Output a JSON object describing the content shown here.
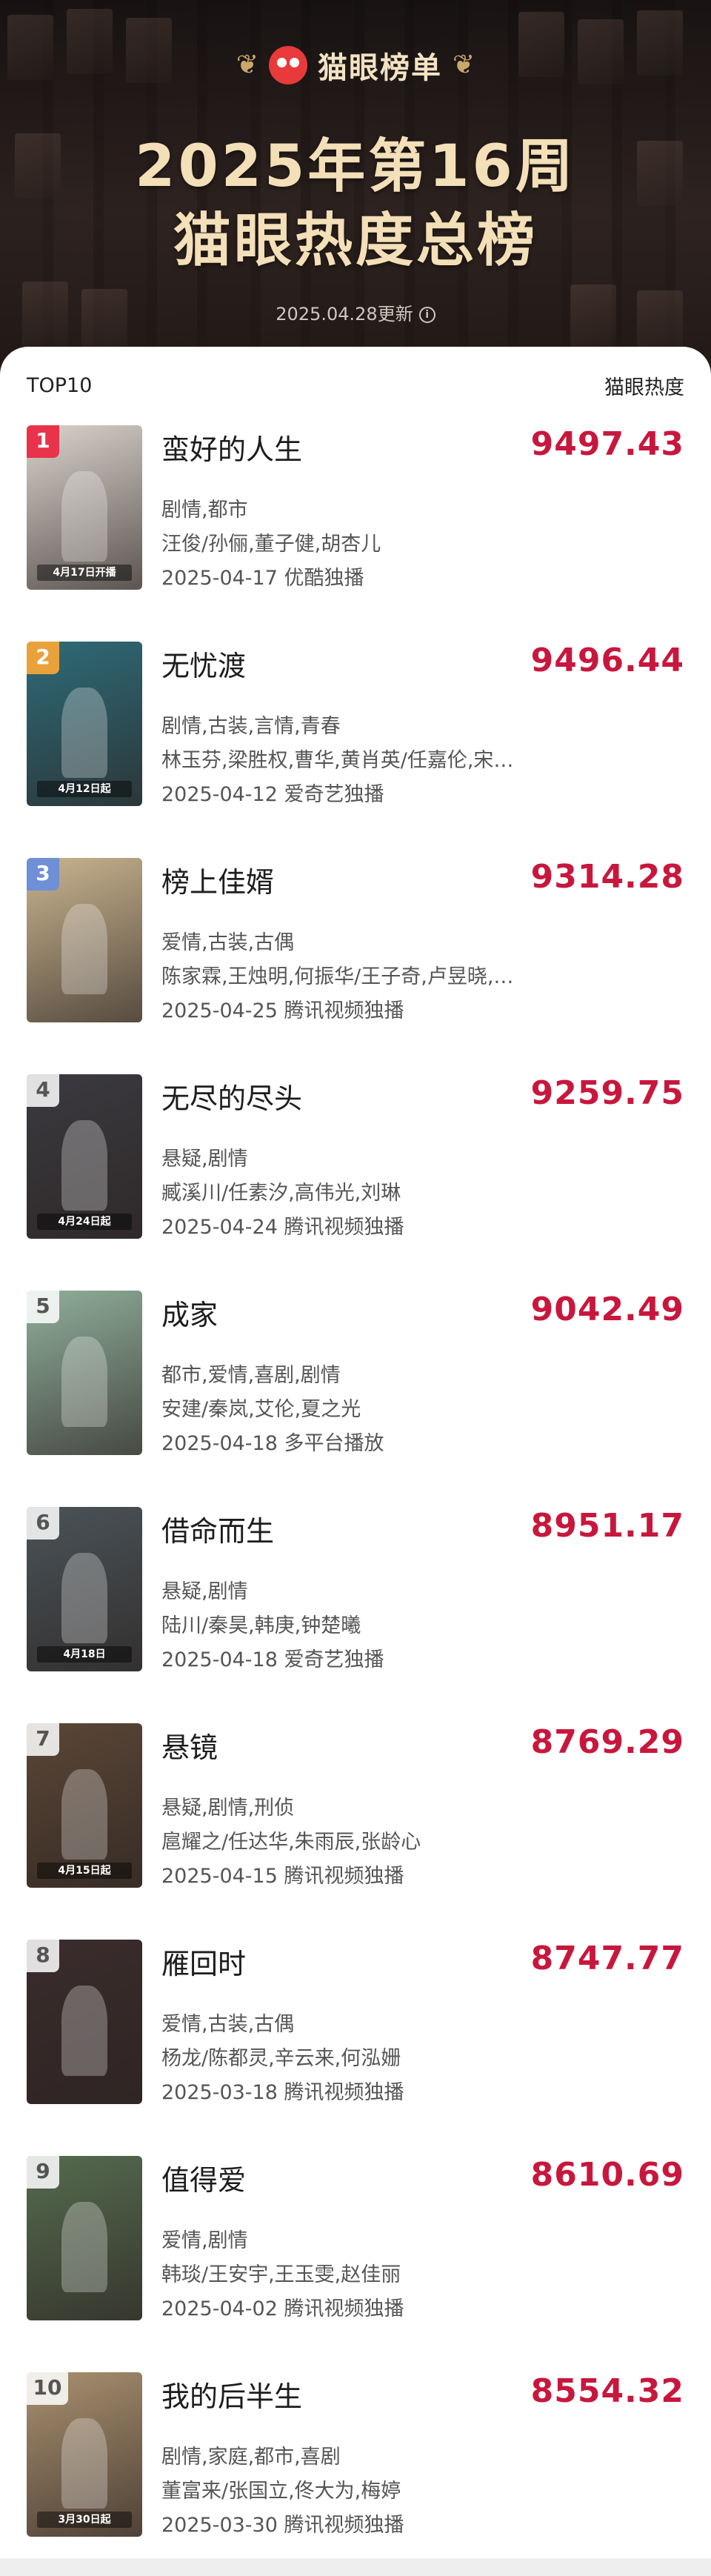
{
  "header": {
    "brand": "猫眼榜单",
    "title_line1": "2025年第16周",
    "title_line2": "猫眼热度总榜",
    "update_text": "2025.04.28更新",
    "info_icon": "info-icon"
  },
  "list_header": {
    "left": "TOP10",
    "right": "猫眼热度"
  },
  "items": [
    {
      "rank": "1",
      "title": "蛮好的人生",
      "heat": "9497.43",
      "genres": "剧情,都市",
      "cast": "汪俊/孙俪,董子健,胡杏儿",
      "release": "2025-04-17 优酷独播",
      "poster_tag": "4月17日开播",
      "poster_color": "#d9d3cc"
    },
    {
      "rank": "2",
      "title": "无忧渡",
      "heat": "9496.44",
      "genres": "剧情,古装,言情,青春",
      "cast": "林玉芬,梁胜权,曹华,黄肖英/任嘉伦,宋…",
      "release": "2025-04-12 爱奇艺独播",
      "poster_tag": "4月12日起",
      "poster_color": "#2e6b78"
    },
    {
      "rank": "3",
      "title": "榜上佳婿",
      "heat": "9314.28",
      "genres": "爱情,古装,古偶",
      "cast": "陈家霖,王烛明,何振华/王子奇,卢昱晓,…",
      "release": "2025-04-25 腾讯视频独播",
      "poster_tag": "",
      "poster_color": "#c9b48f"
    },
    {
      "rank": "4",
      "title": "无尽的尽头",
      "heat": "9259.75",
      "genres": "悬疑,剧情",
      "cast": "臧溪川/任素汐,高伟光,刘琳",
      "release": "2025-04-24 腾讯视频独播",
      "poster_tag": "4月24日起",
      "poster_color": "#3b3a40"
    },
    {
      "rank": "5",
      "title": "成家",
      "heat": "9042.49",
      "genres": "都市,爱情,喜剧,剧情",
      "cast": "安建/秦岚,艾伦,夏之光",
      "release": "2025-04-18 多平台播放",
      "poster_tag": "",
      "poster_color": "#8fae9a"
    },
    {
      "rank": "6",
      "title": "借命而生",
      "heat": "8951.17",
      "genres": "悬疑,剧情",
      "cast": "陆川/秦昊,韩庚,钟楚曦",
      "release": "2025-04-18 爱奇艺独播",
      "poster_tag": "4月18日",
      "poster_color": "#4a5358"
    },
    {
      "rank": "7",
      "title": "悬镜",
      "heat": "8769.29",
      "genres": "悬疑,剧情,刑侦",
      "cast": "扈耀之/任达华,朱雨辰,张龄心",
      "release": "2025-04-15 腾讯视频独播",
      "poster_tag": "4月15日起",
      "poster_color": "#5a4636"
    },
    {
      "rank": "8",
      "title": "雁回时",
      "heat": "8747.77",
      "genres": "爱情,古装,古偶",
      "cast": "杨龙/陈都灵,辛云来,何泓姗",
      "release": "2025-03-18 腾讯视频独播",
      "poster_tag": "",
      "poster_color": "#3a2c2c"
    },
    {
      "rank": "9",
      "title": "值得爱",
      "heat": "8610.69",
      "genres": "爱情,剧情",
      "cast": "韩琰/王安宇,王玉雯,赵佳丽",
      "release": "2025-04-02 腾讯视频独播",
      "poster_tag": "",
      "poster_color": "#556b4f"
    },
    {
      "rank": "10",
      "title": "我的后半生",
      "heat": "8554.32",
      "genres": "剧情,家庭,都市,喜剧",
      "cast": "董富来/张国立,佟大为,梅婷",
      "release": "2025-03-30 腾讯视频独播",
      "poster_tag": "3月30日起",
      "poster_color": "#a9906f"
    }
  ],
  "colors": {
    "heat": "#c8173d",
    "rank1": "#e8334a",
    "rank2": "#e9a23b",
    "rank3": "#6f8fd6"
  }
}
